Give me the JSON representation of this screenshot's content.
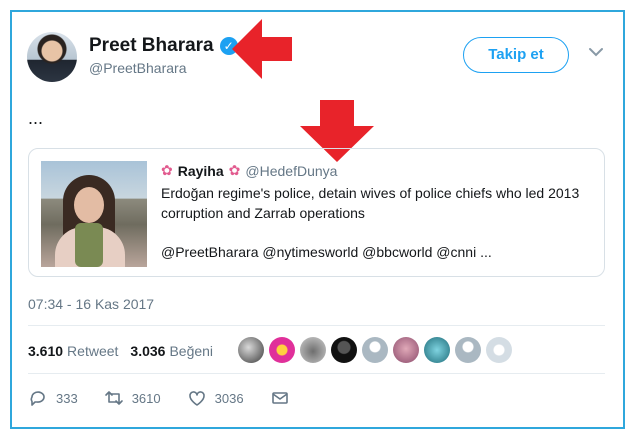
{
  "author": {
    "name": "Preet Bharara",
    "handle": "@PreetBharara",
    "verified_icon": "verified-badge-icon"
  },
  "follow_label": "Takip et",
  "tweet_text": "...",
  "quoted": {
    "name": "Rayiha",
    "handle": "@HedefDunya",
    "text": "Erdoğan regime's police, detain wives of police chiefs who led 2013 corruption and Zarrab operations",
    "mentions": "@PreetBharara @nytimesworld @bbcworld @cnni  ..."
  },
  "timestamp": "07:34 - 16 Kas 2017",
  "stats": {
    "retweets_count": "3.610",
    "retweets_label": "Retweet",
    "likes_count": "3.036",
    "likes_label": "Beğeni"
  },
  "likers_count_shown": 9,
  "actions": {
    "replies": "333",
    "retweets": "3610",
    "likes": "3036"
  },
  "colors": {
    "accent": "#1da1f2",
    "annotation_arrow": "#e8232a",
    "frame_border": "#2fa7dc"
  }
}
